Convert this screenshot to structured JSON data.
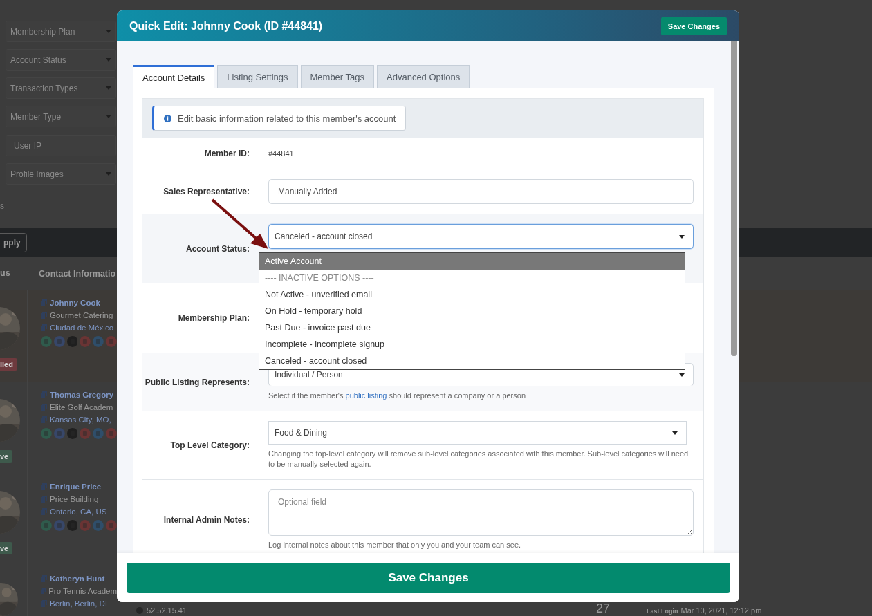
{
  "background": {
    "filters": [
      {
        "kind": "select",
        "label": "Membership Plan"
      },
      {
        "kind": "select",
        "label": "Account Status"
      },
      {
        "kind": "select",
        "label": "Transaction Types"
      },
      {
        "kind": "select",
        "label": "Member Type"
      },
      {
        "kind": "input",
        "placeholder": "User IP"
      },
      {
        "kind": "select",
        "label": "Profile Images"
      }
    ],
    "stub_text": "s",
    "apply_button": "pply",
    "columns": [
      "us",
      "Contact Informatio"
    ],
    "members": [
      {
        "name": "Johnny Cook",
        "company": "Gourmet Catering",
        "location": "Ciudad de México",
        "badge": "lled",
        "color": "#6e3a3e"
      },
      {
        "name": "Thomas Gregory",
        "company": "Elite Golf Academ",
        "location": "Kansas City, MO,",
        "badge": "ve",
        "color": "#3e5a4c"
      },
      {
        "name": "Enrique Price",
        "company": "Price Building",
        "location": "Ontario, CA, US",
        "badge": "ve",
        "color": "#3e5a4c"
      },
      {
        "name": "Katheryn Hunt",
        "company": "Pro Tennis Academ",
        "location": "Berlin, Berlin, DE",
        "ip": "52.52.15.41",
        "count": "27",
        "last_login_label": "Last Login",
        "last_login": "Mar 10, 2021, 12:12 pm"
      }
    ]
  },
  "modal": {
    "title": "Quick Edit: Johnny Cook (ID #44841)",
    "header_button": "Save Changes",
    "tabs": [
      {
        "label": "Account Details",
        "selected": true
      },
      {
        "label": "Listing Settings",
        "selected": false
      },
      {
        "label": "Member Tags",
        "selected": false
      },
      {
        "label": "Advanced Options",
        "selected": false
      }
    ],
    "info": "Edit basic information related to this member's account",
    "fields": [
      {
        "kind": "static",
        "label": "Member ID:",
        "value": "#44841"
      },
      {
        "kind": "input",
        "label": "Sales Representative:",
        "value": "Manually Added"
      },
      {
        "kind": "dropdown",
        "label": "Account Status:",
        "value": "Canceled - account closed",
        "options": [
          {
            "label": "Active Account",
            "highlighted": true,
            "disabled": false
          },
          {
            "label": "---- INACTIVE OPTIONS ----",
            "highlighted": false,
            "disabled": true
          },
          {
            "label": "Not Active - unverified email",
            "highlighted": false,
            "disabled": false
          },
          {
            "label": "On Hold - temporary hold",
            "highlighted": false,
            "disabled": false
          },
          {
            "label": "Past Due - invoice past due",
            "highlighted": false,
            "disabled": false
          },
          {
            "label": "Incomplete - incomplete signup",
            "highlighted": false,
            "disabled": false
          },
          {
            "label": "Canceled - account closed",
            "highlighted": false,
            "disabled": false
          }
        ]
      },
      {
        "kind": "covered",
        "label": "Membership Plan:"
      },
      {
        "kind": "select",
        "label": "Public Listing Represents:",
        "value": "Individual / Person",
        "help_before": "Select if the member's",
        "help_link": "public listing",
        "help_after": "should represent a company or a person"
      },
      {
        "kind": "select",
        "label": "Top Level Category:",
        "value": "Food & Dining",
        "help": "Changing the top-level category will remove sub-level categories associated with this member. Sub-level categories will need to be manually selected again."
      },
      {
        "kind": "textarea",
        "label": "Internal Admin Notes:",
        "placeholder": "Optional field",
        "help": "Log internal notes about this member that only you and your team can see."
      }
    ],
    "footer_button": "Save Changes"
  }
}
